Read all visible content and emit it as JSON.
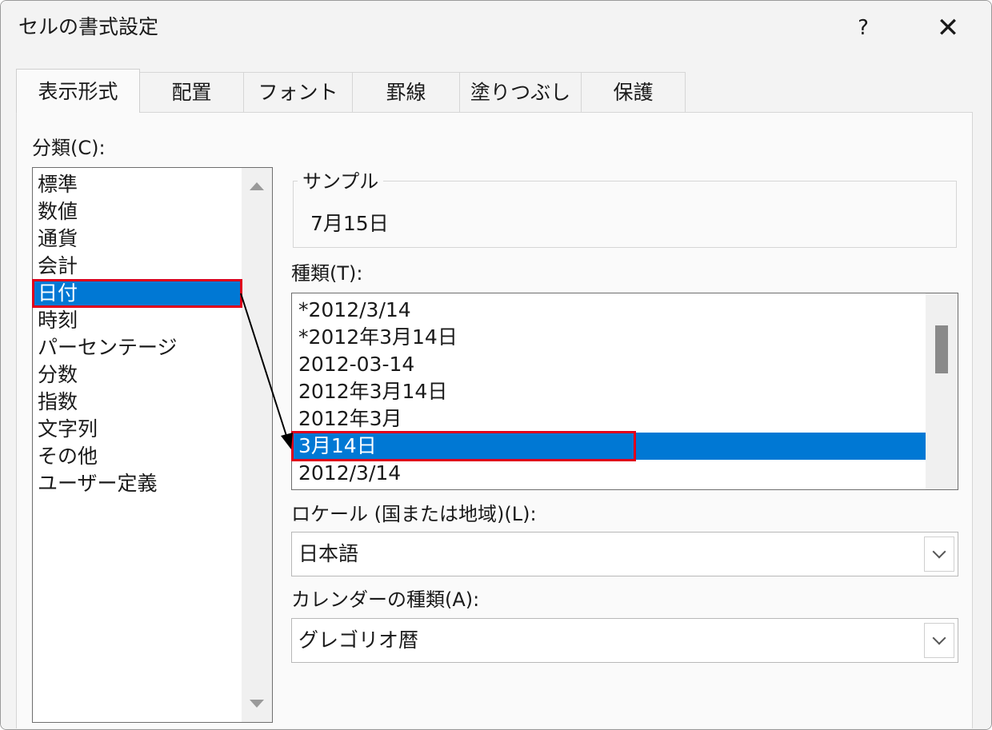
{
  "window": {
    "title": "セルの書式設定",
    "help_symbol": "?",
    "close_symbol": "✕"
  },
  "tabs": [
    {
      "label": "表示形式",
      "active": true
    },
    {
      "label": "配置"
    },
    {
      "label": "フォント"
    },
    {
      "label": "罫線"
    },
    {
      "label": "塗りつぶし"
    },
    {
      "label": "保護"
    }
  ],
  "category": {
    "label": "分類(C):",
    "selected_index": 4,
    "items": [
      "標準",
      "数値",
      "通貨",
      "会計",
      "日付",
      "時刻",
      "パーセンテージ",
      "分数",
      "指数",
      "文字列",
      "その他",
      "ユーザー定義"
    ]
  },
  "sample": {
    "legend": "サンプル",
    "value": "7月15日"
  },
  "type": {
    "label": "種類(T):",
    "selected_index": 5,
    "items": [
      "*2012/3/14",
      "*2012年3月14日",
      "2012-03-14",
      "2012年3月14日",
      "2012年3月",
      "3月14日",
      "2012/3/14"
    ]
  },
  "locale": {
    "label": "ロケール (国または地域)(L):",
    "value": "日本語"
  },
  "calendar": {
    "label": "カレンダーの種類(A):",
    "value": "グレゴリオ暦"
  },
  "colors": {
    "selection": "#0078d4",
    "highlight": "#e0001b"
  }
}
